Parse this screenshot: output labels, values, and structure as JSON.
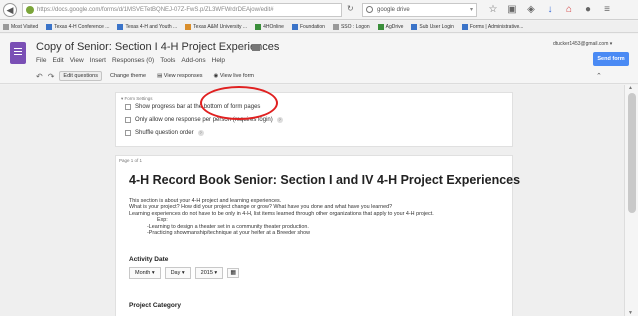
{
  "browser": {
    "url": "https://docs.google.com/forms/d/1MSVETetBQNEJ-07Z-FwS.p/ZL3WFWrdrDEAjow/edit#",
    "search_placeholder": "google drive",
    "back_icon": "back-arrow-icon",
    "bookmarks": [
      {
        "label": "Most Visited",
        "icon": "gear-icon"
      },
      {
        "label": "Texas 4-H Conference ...",
        "icon": "tx-icon"
      },
      {
        "label": "Texas 4-H and Youth ...",
        "icon": "tx-icon"
      },
      {
        "label": "Texas A&M University ...",
        "icon": "tamu-icon"
      },
      {
        "label": "4HOnline",
        "icon": "clover-icon"
      },
      {
        "label": "Foundation",
        "icon": "doc-icon"
      },
      {
        "label": "SSO : Logon",
        "icon": "page-icon"
      },
      {
        "label": "AgDrive",
        "icon": "drive-icon"
      },
      {
        "label": "Sub User Login",
        "icon": "doc-icon"
      },
      {
        "label": "Forms | Administrative...",
        "icon": "tx-icon"
      }
    ]
  },
  "header": {
    "title": "Copy of Senior: Section I 4-H Project Experiences",
    "menu": [
      "File",
      "Edit",
      "View",
      "Insert",
      "Responses (0)",
      "Tools",
      "Add-ons",
      "Help"
    ],
    "account": "dtucker1453@gmail.com ▾",
    "send_label": "Send form",
    "toolbar": {
      "edit": "Edit questions",
      "theme": "Change theme",
      "responses": "View responses",
      "live": "View live form"
    }
  },
  "settings": {
    "label": "▾ Form Settings",
    "options": [
      "Show progress bar at the bottom of form pages",
      "Only allow one response per person (requires login)",
      "Shuffle question order"
    ]
  },
  "form": {
    "page_label": "Page 1 of 1",
    "title": "4-H Record Book Senior: Section I and IV 4-H Project Experiences",
    "description": [
      "This section is about your 4-H project and learning experiences.",
      "What is your project? How did your project change or grow? What have you done and what have you learned?",
      "Learning experiences do not have to be only in 4-H, list items learned through other organizations that apply to your 4-H project.",
      "          Exp:",
      "          -Learning to design a theater set in a community theater production.",
      "          -Practicing showmanship/technique at your heifer at a Breeder show"
    ],
    "activity_date_label": "Activity Date",
    "month": "Month ▾",
    "day": "Day ▾",
    "year": "2015 ▾",
    "project_category_label": "Project Category"
  },
  "colors": {
    "accent": "#4a8af4",
    "forms_purple": "#7a4fb5",
    "annotation_red": "#e02020"
  }
}
